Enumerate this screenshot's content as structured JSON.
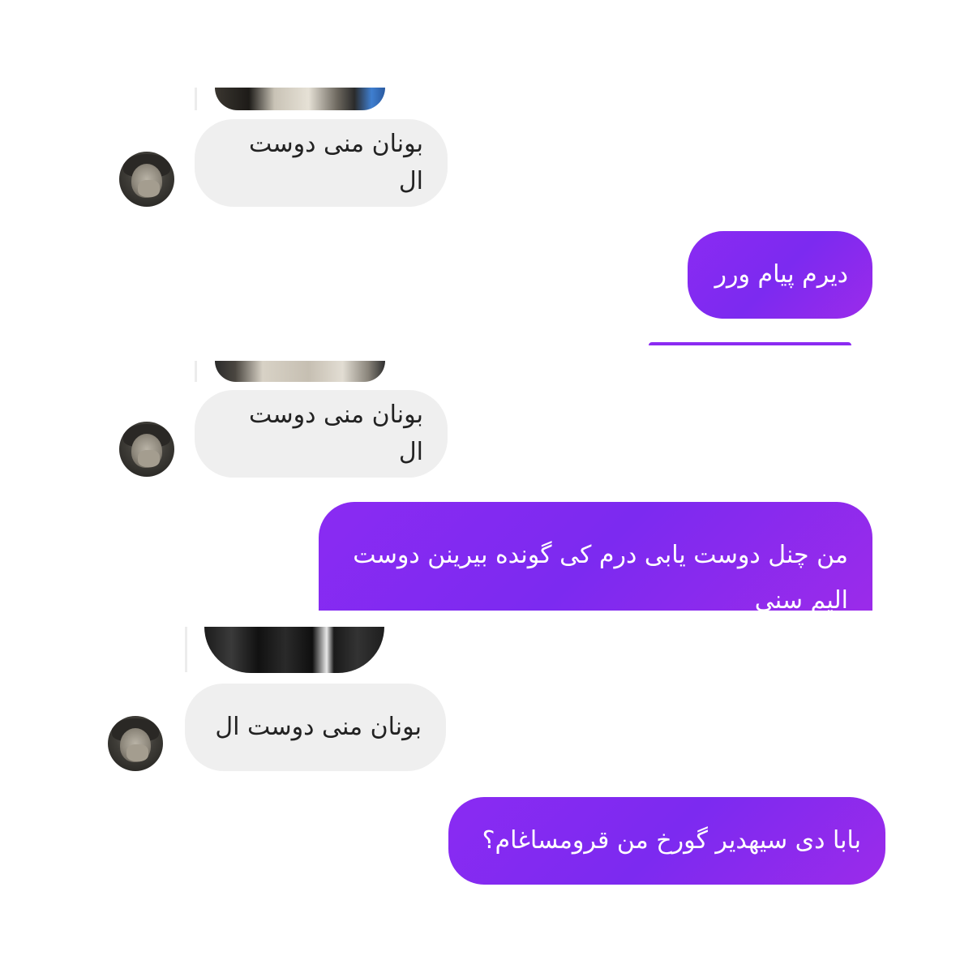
{
  "colors": {
    "incoming_bubble": "#efefef",
    "outgoing_bubble": "#8a2bf2",
    "incoming_text": "#222222",
    "outgoing_text": "#ffffff"
  },
  "messages": [
    {
      "direction": "incoming",
      "text": "بونان منی دوست ال"
    },
    {
      "direction": "outgoing",
      "text": "دیرم پیام ورر"
    },
    {
      "direction": "incoming",
      "text": "بونان منی دوست ال"
    },
    {
      "direction": "outgoing",
      "text": "من چنل دوست یابی درم کی گونده بیرینن دوست الیم سنی"
    },
    {
      "direction": "incoming",
      "text": "بونان منی دوست ال"
    },
    {
      "direction": "outgoing",
      "text": "بابا دی سیهدیر گورخ من قرومساغام؟"
    }
  ],
  "icons": {
    "avatar": "user-avatar-photo",
    "media": "shared-photo-thumbnail"
  }
}
